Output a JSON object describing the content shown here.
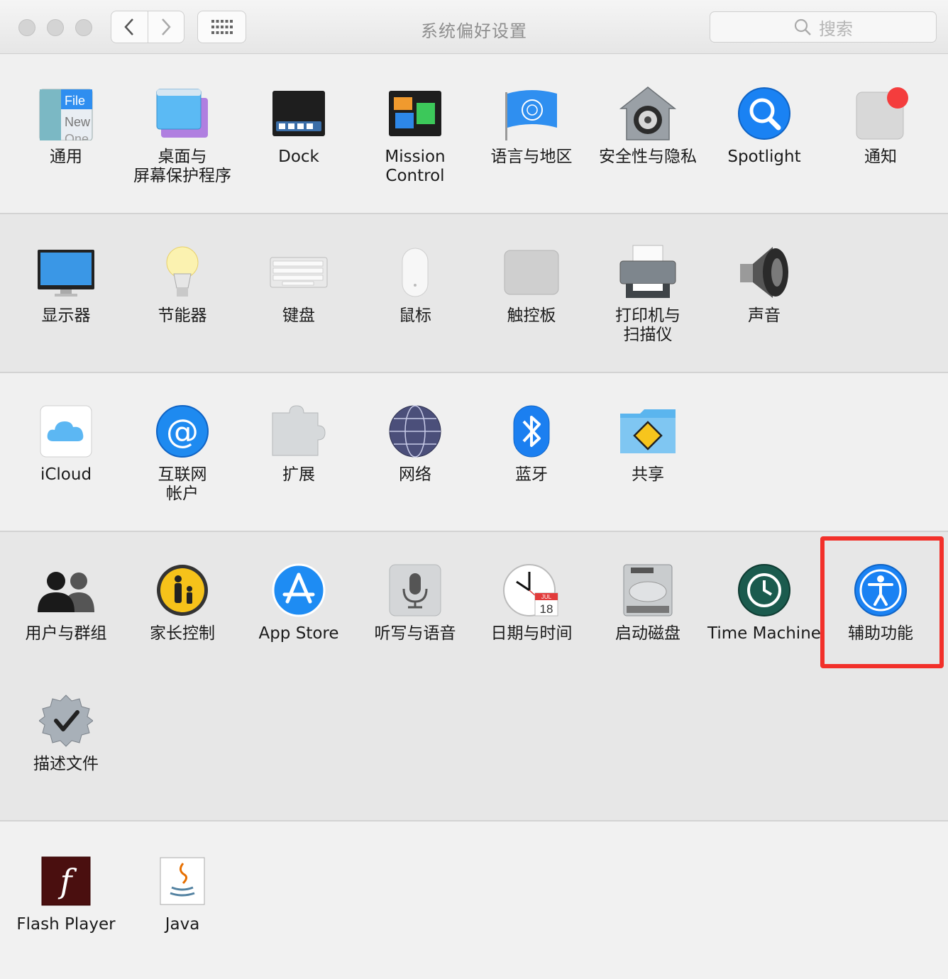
{
  "window": {
    "title": "系统偏好设置"
  },
  "search": {
    "placeholder": "搜索"
  },
  "sections": [
    {
      "items": [
        {
          "id": "general",
          "label": "通用",
          "icon": "general-icon",
          "icon_text": [
            "File",
            "New",
            "One"
          ]
        },
        {
          "id": "desktop",
          "label": "桌面与\n屏幕保护程序",
          "icon": "desktop-screensaver-icon"
        },
        {
          "id": "dock",
          "label": "Dock",
          "icon": "dock-icon"
        },
        {
          "id": "mission",
          "label": "Mission\nControl",
          "icon": "mission-control-icon"
        },
        {
          "id": "language",
          "label": "语言与地区",
          "icon": "un-flag-icon"
        },
        {
          "id": "security",
          "label": "安全性与隐私",
          "icon": "security-house-icon"
        },
        {
          "id": "spotlight",
          "label": "Spotlight",
          "icon": "spotlight-icon"
        },
        {
          "id": "notifications",
          "label": "通知",
          "icon": "notifications-icon"
        }
      ]
    },
    {
      "items": [
        {
          "id": "displays",
          "label": "显示器",
          "icon": "display-icon"
        },
        {
          "id": "energy",
          "label": "节能器",
          "icon": "light-bulb-icon"
        },
        {
          "id": "keyboard",
          "label": "键盘",
          "icon": "keyboard-icon"
        },
        {
          "id": "mouse",
          "label": "鼠标",
          "icon": "mouse-icon"
        },
        {
          "id": "trackpad",
          "label": "触控板",
          "icon": "trackpad-icon"
        },
        {
          "id": "printers",
          "label": "打印机与\n扫描仪",
          "icon": "printer-icon"
        },
        {
          "id": "sound",
          "label": "声音",
          "icon": "speaker-icon"
        }
      ]
    },
    {
      "items": [
        {
          "id": "icloud",
          "label": "iCloud",
          "icon": "icloud-icon"
        },
        {
          "id": "internet-accounts",
          "label": "互联网\n帐户",
          "icon": "at-sign-icon",
          "icon_text": "@"
        },
        {
          "id": "extensions",
          "label": "扩展",
          "icon": "puzzle-piece-icon"
        },
        {
          "id": "network",
          "label": "网络",
          "icon": "globe-icon"
        },
        {
          "id": "bluetooth",
          "label": "蓝牙",
          "icon": "bluetooth-icon"
        },
        {
          "id": "sharing",
          "label": "共享",
          "icon": "sharing-folder-icon"
        }
      ]
    },
    {
      "items": [
        {
          "id": "users",
          "label": "用户与群组",
          "icon": "users-icon"
        },
        {
          "id": "parental",
          "label": "家长控制",
          "icon": "parental-controls-icon"
        },
        {
          "id": "appstore",
          "label": "App Store",
          "icon": "app-store-icon"
        },
        {
          "id": "dictation",
          "label": "听写与语音",
          "icon": "microphone-icon"
        },
        {
          "id": "datetime",
          "label": "日期与时间",
          "icon": "clock-calendar-icon",
          "icon_text": [
            "JUL",
            "18"
          ]
        },
        {
          "id": "startup",
          "label": "启动磁盘",
          "icon": "hard-disk-icon"
        },
        {
          "id": "timemachine",
          "label": "Time Machine",
          "icon": "time-machine-icon"
        },
        {
          "id": "accessibility",
          "label": "辅助功能",
          "icon": "accessibility-icon"
        },
        {
          "id": "profiles",
          "label": "描述文件",
          "icon": "profiles-badge-icon"
        }
      ]
    },
    {
      "items": [
        {
          "id": "flash",
          "label": "Flash Player",
          "icon": "flash-player-icon",
          "icon_text": "f"
        },
        {
          "id": "java",
          "label": "Java",
          "icon": "java-icon"
        }
      ]
    }
  ],
  "colors": {
    "highlight": "#f2302a",
    "accent_blue": "#1a82f3"
  }
}
